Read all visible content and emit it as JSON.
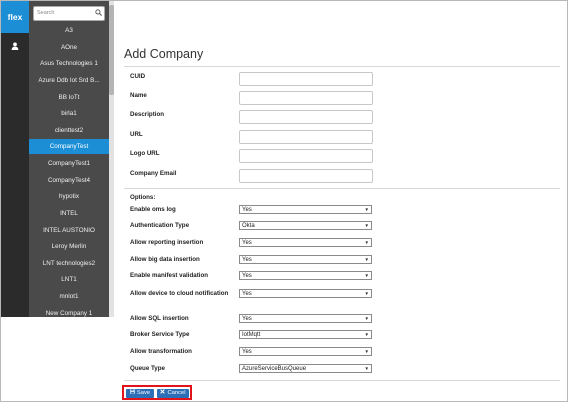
{
  "app": {
    "logo": "flex"
  },
  "sidebar": {
    "search_placeholder": "Search",
    "companies": [
      "A3",
      "AOne",
      "Asus Technologies 1",
      "Azure Ddb Iot Srd B...",
      "BB IoTt",
      "birla1",
      "clienttest2",
      "CompanyTest",
      "CompanyTest1",
      "CompanyTest4",
      "hypotix",
      "INTEL",
      "INTEL AUSTONIO",
      "Leroy Merlin",
      "LNT technologies2",
      "LNT1",
      "mnlot1",
      "New Company 1"
    ],
    "active_company": "CompanyTest"
  },
  "form": {
    "title": "Add Company",
    "fields": [
      {
        "label": "CUID",
        "value": ""
      },
      {
        "label": "Name",
        "value": ""
      },
      {
        "label": "Description",
        "value": ""
      },
      {
        "label": "URL",
        "value": ""
      },
      {
        "label": "Logo URL",
        "value": ""
      },
      {
        "label": "Company Email",
        "value": ""
      }
    ],
    "options_title": "Options:",
    "options": [
      {
        "label": "Enable oms log",
        "value": "Yes"
      },
      {
        "label": "Authentication Type",
        "value": "Okta"
      },
      {
        "label": "Allow reporting insertion",
        "value": "Yes"
      },
      {
        "label": "Allow big data insertion",
        "value": "Yes"
      },
      {
        "label": "Enable manifest validation",
        "value": "Yes"
      },
      {
        "label": "Allow device to cloud notification",
        "value": "Yes"
      },
      {
        "label": "Allow SQL insertion",
        "value": "Yes"
      },
      {
        "label": "Broker Service Type",
        "value": "IotMqtt"
      },
      {
        "label": "Allow transformation",
        "value": "Yes"
      },
      {
        "label": "Queue Type",
        "value": "AzureServiceBusQueue"
      }
    ],
    "save_label": "Save",
    "cancel_label": "Cancel"
  },
  "colors": {
    "accent": "#1b8ed6",
    "button": "#2d6fb7",
    "highlight": "#e2141b"
  }
}
